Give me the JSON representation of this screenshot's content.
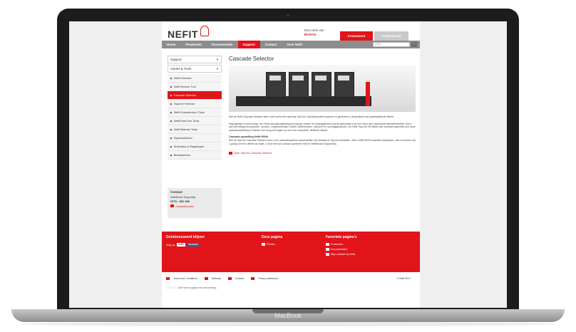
{
  "device": {
    "brand_label": "MacBook"
  },
  "site": {
    "logo": "NEFIT",
    "bosch_tag_line1": "Een merk van",
    "bosch_tag_line2": "BOSCH",
    "top_buttons": [
      "Consument",
      "Professional"
    ],
    "nav": [
      "Home",
      "Producten",
      "Documentatie",
      "Support",
      "Contact",
      "Over Nefit"
    ],
    "nav_active": "Support",
    "search_placeholder": "Zoek",
    "sidebar_selects": [
      "Support",
      "Advies & Tools"
    ],
    "sidebar_items": [
      "Nefit eService",
      "Nefit Service Tool",
      "Cascade Selector",
      "TopLine Selector",
      "Nefit Zonnestroom Tools",
      "Nefit EnerLine Tools",
      "Nefit Warmte Tools",
      "Systeemkiezer",
      "Subsidies & Regelingen",
      "Bestelservice"
    ],
    "sidebar_active": "Cascade Selector",
    "contact": {
      "title": "Contact",
      "line1": "Nefit/Bosch Supportlijn",
      "phone": "0575 - 892 380",
      "link": "Contactformulier"
    },
    "main": {
      "title": "Cascade Selector",
      "para1": "Met de Nefit Cascade Selector stelt u zelf online het optimale TopLine Cascadesysteem samen en genereert u automatisch een gedetailleerde offerte.",
      "para2": "Stapsgewijs en eenvoudig, een Nefit cascadeopstelling bevolgt zijn kosten en belangrijkheid in grote gebouwen met een meer dan functionele warmtebehoefte. Denk aan (tennis)sportcomplexen, scholen, zorgboerderijen, hotels, ziekenhuizen, kantoren en woninggebouwen. De Nefit TopLine HR-ketels zijn bij uitstek geschikt voor deze cascadeopstelling en bieden een hoog vermogen op een zeer compacte, flexibele manier.",
      "subhead": "Cascade-opstelling Nefit 9000i",
      "para3": "Met de TopLine Cascade Selector kunt u een cascadesysteem samenstellen die bestaat uit TopLine toestellen. Wilt u Nefit 9000i toestellen toepassen, dan verzoeken wij u graag om een offerte op maat. U kunt hiervoor contact opnemen met de Nefit/Bosch Supportlijn.",
      "link": "Naar TopLine Cascade Selector"
    },
    "footer": {
      "col1_title": "Geïnteresseerd blijven",
      "col1_text": "Volg op",
      "social": [
        "twitter",
        "facebook"
      ],
      "col2_title": "Deze pagina",
      "col2_links": [
        "Printen"
      ],
      "col3_title": "Favoriete pagina's",
      "col3_links": [
        "Producten",
        "Documentatie",
        "Mijn contact bij Nefit"
      ]
    },
    "bottom_links": [
      "Terms and Conditions",
      "Sitemap",
      "Cookies",
      "Privacy statement"
    ],
    "copyright": "© Nefit 2017",
    "rating_text": "Geef deze pagina een beoordeling"
  },
  "colors": {
    "brand_red": "#e1141a",
    "nav_grey": "#8d8d8d"
  }
}
